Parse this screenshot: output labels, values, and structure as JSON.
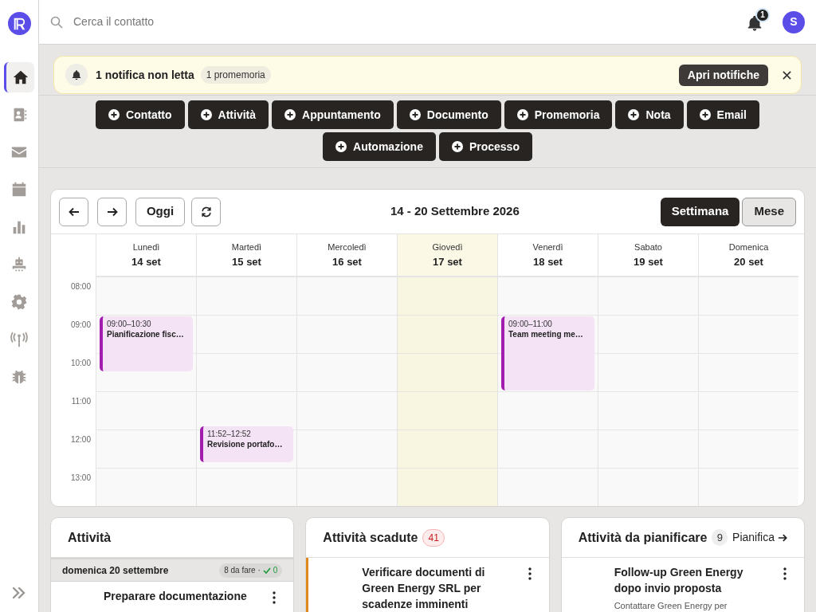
{
  "sidebar": {
    "items": [
      {
        "selected": true
      },
      {
        "selected": false
      },
      {
        "selected": false
      },
      {
        "selected": false
      },
      {
        "selected": false
      },
      {
        "selected": false
      },
      {
        "selected": false
      },
      {
        "selected": false
      },
      {
        "selected": false
      }
    ]
  },
  "topbar": {
    "search": {
      "placeholder": "Cerca il contatto"
    },
    "notification_count": "1",
    "avatar": "S"
  },
  "banner": {
    "title": "1 notifica non letta",
    "badge": "1 promemoria",
    "button": "Apri notifiche"
  },
  "quick_actions": [
    "Contatto",
    "Attività",
    "Appuntamento",
    "Documento",
    "Promemoria",
    "Nota",
    "Email",
    "Automazione",
    "Processo"
  ],
  "calendar": {
    "range": "14 - 20 Settembre 2026",
    "today_button": "Oggi",
    "views": [
      {
        "label": "Settimana",
        "selected": true
      },
      {
        "label": "Mese",
        "selected": false
      }
    ],
    "days": [
      {
        "name": "Lunedì",
        "date": "14 set",
        "today": false,
        "events": [
          {
            "time": "09:00–10:30",
            "title": "Pianificazione fisc…"
          }
        ]
      },
      {
        "name": "Martedì",
        "date": "15 set",
        "today": false,
        "events": [
          {
            "time": "11:52–12:52",
            "title": "Revisione portafo…"
          }
        ]
      },
      {
        "name": "Mercoledì",
        "date": "16 set",
        "today": false
      },
      {
        "name": "Giovedì",
        "date": "17 set",
        "today": true
      },
      {
        "name": "Venerdì",
        "date": "18 set",
        "today": false,
        "events": [
          {
            "time": "09:00–11:00",
            "title": "Team meeting me…"
          }
        ]
      },
      {
        "name": "Sabato",
        "date": "19 set",
        "today": false
      },
      {
        "name": "Domenica",
        "date": "20 set",
        "today": false
      }
    ],
    "hours": [
      "08:00",
      "09:00",
      "10:00",
      "11:00",
      "12:00",
      "13:00"
    ]
  },
  "panels": [
    {
      "title": "Attività",
      "group": {
        "label": "domenica 20 settembre",
        "todo": "8 da fare ·",
        "done": "0"
      },
      "items": [
        {
          "title": "Preparare documentazione"
        }
      ]
    },
    {
      "title": "Attività scadute",
      "count": "41",
      "items": [
        {
          "title": "Verificare documenti di Green Energy SRL per scadenze imminenti"
        }
      ]
    },
    {
      "title": "Attività da pianificare",
      "count": "9",
      "link": "Pianifica",
      "items": [
        {
          "title": "Follow-up Green Energy dopo invio proposta",
          "subtitle": "Contattare Green Energy per"
        }
      ]
    }
  ]
}
